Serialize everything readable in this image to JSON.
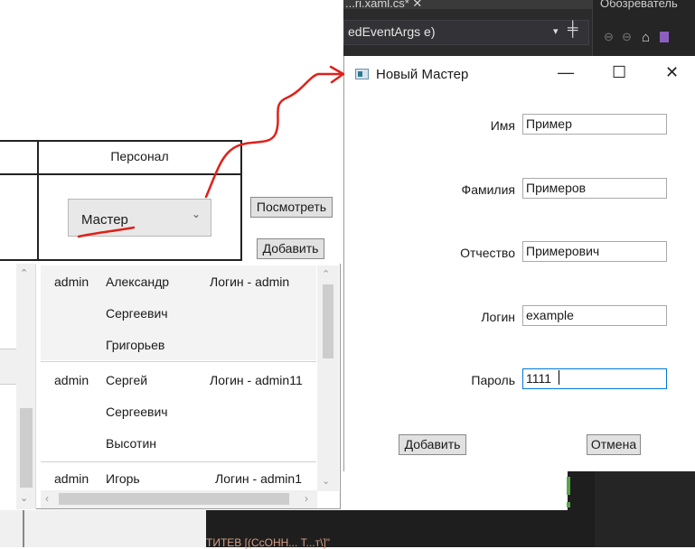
{
  "vs": {
    "tab_title": "...ri.xaml.cs*  ✕",
    "method_combo": "edEventArgs e)",
    "combo_arrow": "▾",
    "split_icon": "╪",
    "explorer_title": "Обозреватель",
    "code_fragment": "ТИТЕВ [(СсОНН... Т...т\\]\""
  },
  "main": {
    "column_header": "Персонал",
    "role_combo": {
      "selected": "Мастер",
      "arrow": "⌄"
    },
    "view_button": "Посмотреть",
    "add_button": "Добавить",
    "list": [
      {
        "role": "admin",
        "name_lines": [
          "Александр",
          "Сергеевич",
          "Григорьев"
        ],
        "login": "Логин - admin"
      },
      {
        "role": "admin",
        "name_lines": [
          "Сергей",
          "Сергеевич",
          "Высотин"
        ],
        "login": "Логин - admin11"
      },
      {
        "role": "admin",
        "name_lines": [
          "Игорь"
        ],
        "login": "Логин - admin1"
      }
    ]
  },
  "dialog": {
    "title": "Новый Мастер",
    "minimize": "—",
    "maximize": "☐",
    "close": "✕",
    "fields": [
      {
        "label": "Имя",
        "value": "Пример"
      },
      {
        "label": "Фамилия",
        "value": "Примеров"
      },
      {
        "label": "Отчество",
        "value": "Примерович"
      },
      {
        "label": "Логин",
        "value": "example"
      },
      {
        "label": "Пароль",
        "value": "1111"
      }
    ],
    "add_button": "Добавить",
    "cancel_button": "Отмена"
  },
  "colors": {
    "annotation": "#e0201a",
    "vs_dark": "#2b2b2b",
    "focus": "#0078d7"
  },
  "scroll_glyphs": {
    "up": "⌃",
    "down": "⌄",
    "left": "‹",
    "right": "›"
  }
}
